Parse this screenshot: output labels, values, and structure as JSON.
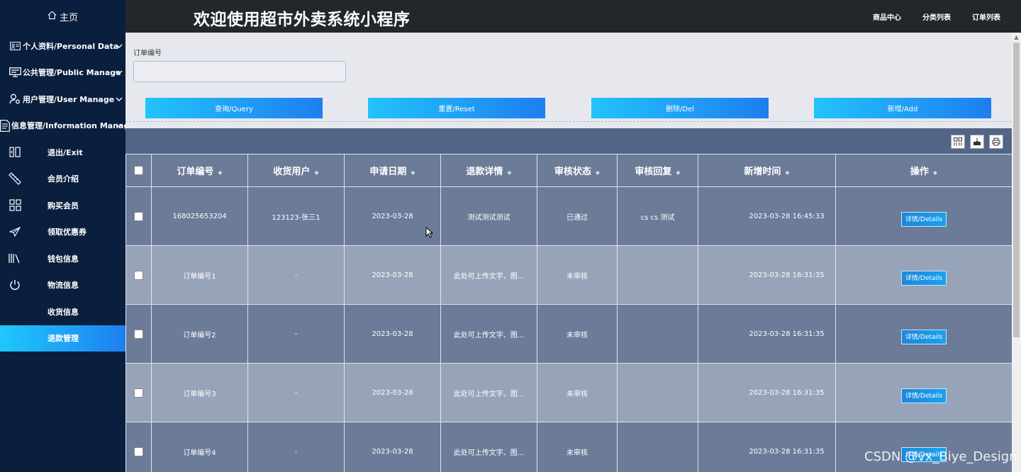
{
  "sidebar": {
    "home": {
      "icon": "home-icon",
      "label": "主页"
    },
    "groups": [
      {
        "icon": "id-card-icon",
        "label": "个人资料/Personal Data"
      },
      {
        "icon": "monitor-icon",
        "label": "公共管理/Public Manage"
      },
      {
        "icon": "user-gear-icon",
        "label": "用户管理/User Manage"
      },
      {
        "icon": "document-icon",
        "label": "信息管理/Information Manage"
      }
    ],
    "items": [
      {
        "icon": "exit-icon",
        "label": "退出/Exit"
      },
      {
        "icon": "ruler-icon",
        "label": "会员介绍"
      },
      {
        "icon": "grid-icon",
        "label": "购买会员"
      },
      {
        "icon": "send-icon",
        "label": "领取优惠券"
      },
      {
        "icon": "library-icon",
        "label": "钱包信息"
      },
      {
        "icon": "power-icon",
        "label": "物流信息"
      },
      {
        "icon": "",
        "label": "收货信息"
      },
      {
        "icon": "",
        "label": "退款管理",
        "active": true
      }
    ]
  },
  "header": {
    "title": "欢迎使用超市外卖系统小程序",
    "nav": [
      "商品中心",
      "分类列表",
      "订单列表"
    ]
  },
  "search": {
    "label": "订单编号",
    "value": "",
    "placeholder": ""
  },
  "buttons": {
    "query": "查询/Query",
    "reset": "重置/Reset",
    "delete": "删除/Del",
    "add": "新增/Add"
  },
  "toolbar_icons": [
    "columns-icon",
    "export-icon",
    "print-icon"
  ],
  "table": {
    "columns": [
      "订单编号",
      "收货用户",
      "申请日期",
      "退款详情",
      "审核状态",
      "审核回复",
      "新增时间",
      "操作"
    ],
    "rows": [
      {
        "order_no": "168025653204",
        "user": "123123-张三1",
        "date": "2023-03-28",
        "detail": "测试测试测试",
        "status": "已通过",
        "reply": "cs cs 测试",
        "created": "2023-03-28 16:45:33",
        "action": "详情/Details"
      },
      {
        "order_no": "订单编号1",
        "user": "-",
        "date": "2023-03-28",
        "detail": "此处可上传文字、图...",
        "status": "未审核",
        "reply": "",
        "created": "2023-03-28 16:31:35",
        "action": "详情/Details"
      },
      {
        "order_no": "订单编号2",
        "user": "-",
        "date": "2023-03-28",
        "detail": "此处可上传文字、图...",
        "status": "未审核",
        "reply": "",
        "created": "2023-03-28 16:31:35",
        "action": "详情/Details"
      },
      {
        "order_no": "订单编号3",
        "user": "-",
        "date": "2023-03-28",
        "detail": "此处可上传文字、图...",
        "status": "未审核",
        "reply": "",
        "created": "2023-03-28 16:31:35",
        "action": "详情/Details"
      },
      {
        "order_no": "订单编号4",
        "user": "-",
        "date": "2023-03-28",
        "detail": "此处可上传文字、图...",
        "status": "未审核",
        "reply": "",
        "created": "2023-03-28 16:31:35",
        "action": "详情/Details"
      }
    ]
  },
  "watermark": "CSDN @vx_Biye_Design",
  "colors": {
    "sidebar_bg": "#0a1e3e",
    "header_bg": "#23272c",
    "accent_gradient_start": "#22c3fb",
    "accent_gradient_end": "#1e7ef0",
    "table_bg": "#536587",
    "row_dark": "#6b7b98",
    "row_light": "#97a3b8"
  }
}
